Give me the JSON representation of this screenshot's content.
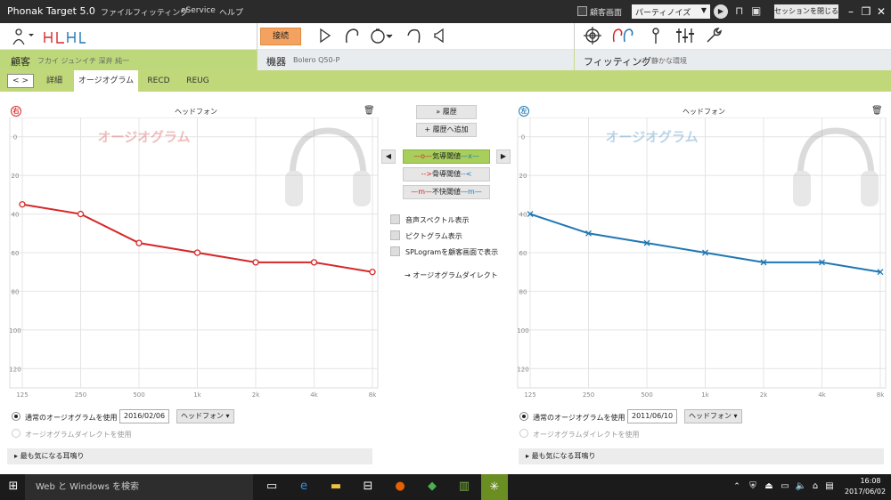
{
  "app": {
    "title": "Phonak Target 5.0",
    "menu": [
      "ファイル",
      "フィッティング",
      "eService",
      "ヘルプ"
    ],
    "client_screen_label": "顧客画面",
    "noise_select": "パーティノイズ",
    "close_session": "セッションを閉じる"
  },
  "toolbar": {
    "connect_label": "接続"
  },
  "header": {
    "client_label": "顧客",
    "client_name": "フカイ ジュンイチ 深井 純一",
    "device_label": "機器",
    "device_name": "Bolero Q50-P",
    "fitting_label": "フィッティング",
    "fitting_env": "静かな環境"
  },
  "tabs": [
    "詳細",
    "オージオグラム",
    "RECD",
    "REUG"
  ],
  "panels": {
    "right": {
      "badge": "右",
      "header": "ヘッドフォン",
      "watermark": "オージオグラム",
      "color": "#d62728"
    },
    "left": {
      "badge": "左",
      "header": "ヘッドフォン",
      "watermark": "オージオグラム",
      "color": "#1f77b4"
    }
  },
  "middle": {
    "history": "履歴",
    "add_history": "履歴へ追加",
    "ac": "気導閾値",
    "bc": "骨導閾値",
    "ucl": "不快閾値",
    "options": [
      "音声スペクトル表示",
      "ピクトグラム表示",
      "SPLogramを顧客画面で表示"
    ],
    "direct": "オージオグラムダイレクト"
  },
  "bottom": {
    "right": {
      "use_normal": "通常のオージオグラムを使用",
      "date": "2016/02/06",
      "transducer": "ヘッドフォン",
      "use_direct": "オージオグラムダイレクトを使用",
      "tinnitus": "最も気になる耳鳴り"
    },
    "left": {
      "use_normal": "通常のオージオグラムを使用",
      "date": "2011/06/10",
      "transducer": "ヘッドフォン",
      "use_direct": "オージオグラムダイレクトを使用",
      "tinnitus": "最も気になる耳鳴り"
    }
  },
  "taskbar": {
    "search": "Web と Windows を検索",
    "time": "16:08",
    "date": "2017/06/02"
  },
  "chart_data": [
    {
      "type": "line",
      "title": "",
      "x": [
        "125",
        "250",
        "500",
        "1k",
        "2k",
        "4k",
        "8k"
      ],
      "yticks": [
        "0",
        "20",
        "40",
        "60",
        "80",
        "100",
        "120"
      ],
      "ylim": [
        -10,
        130
      ],
      "y_inverted": true,
      "grid": true,
      "series": [
        {
          "values": [
            35,
            40,
            55,
            60,
            65,
            65,
            70
          ],
          "color": "#d62728",
          "marker": "o"
        }
      ]
    },
    {
      "type": "line",
      "title": "",
      "x": [
        "125",
        "250",
        "500",
        "1k",
        "2k",
        "4k",
        "8k"
      ],
      "yticks": [
        "0",
        "20",
        "40",
        "60",
        "80",
        "100",
        "120"
      ],
      "ylim": [
        -10,
        130
      ],
      "y_inverted": true,
      "grid": true,
      "series": [
        {
          "values": [
            40,
            50,
            55,
            60,
            65,
            65,
            70
          ],
          "color": "#1f77b4",
          "marker": "x"
        }
      ]
    }
  ]
}
